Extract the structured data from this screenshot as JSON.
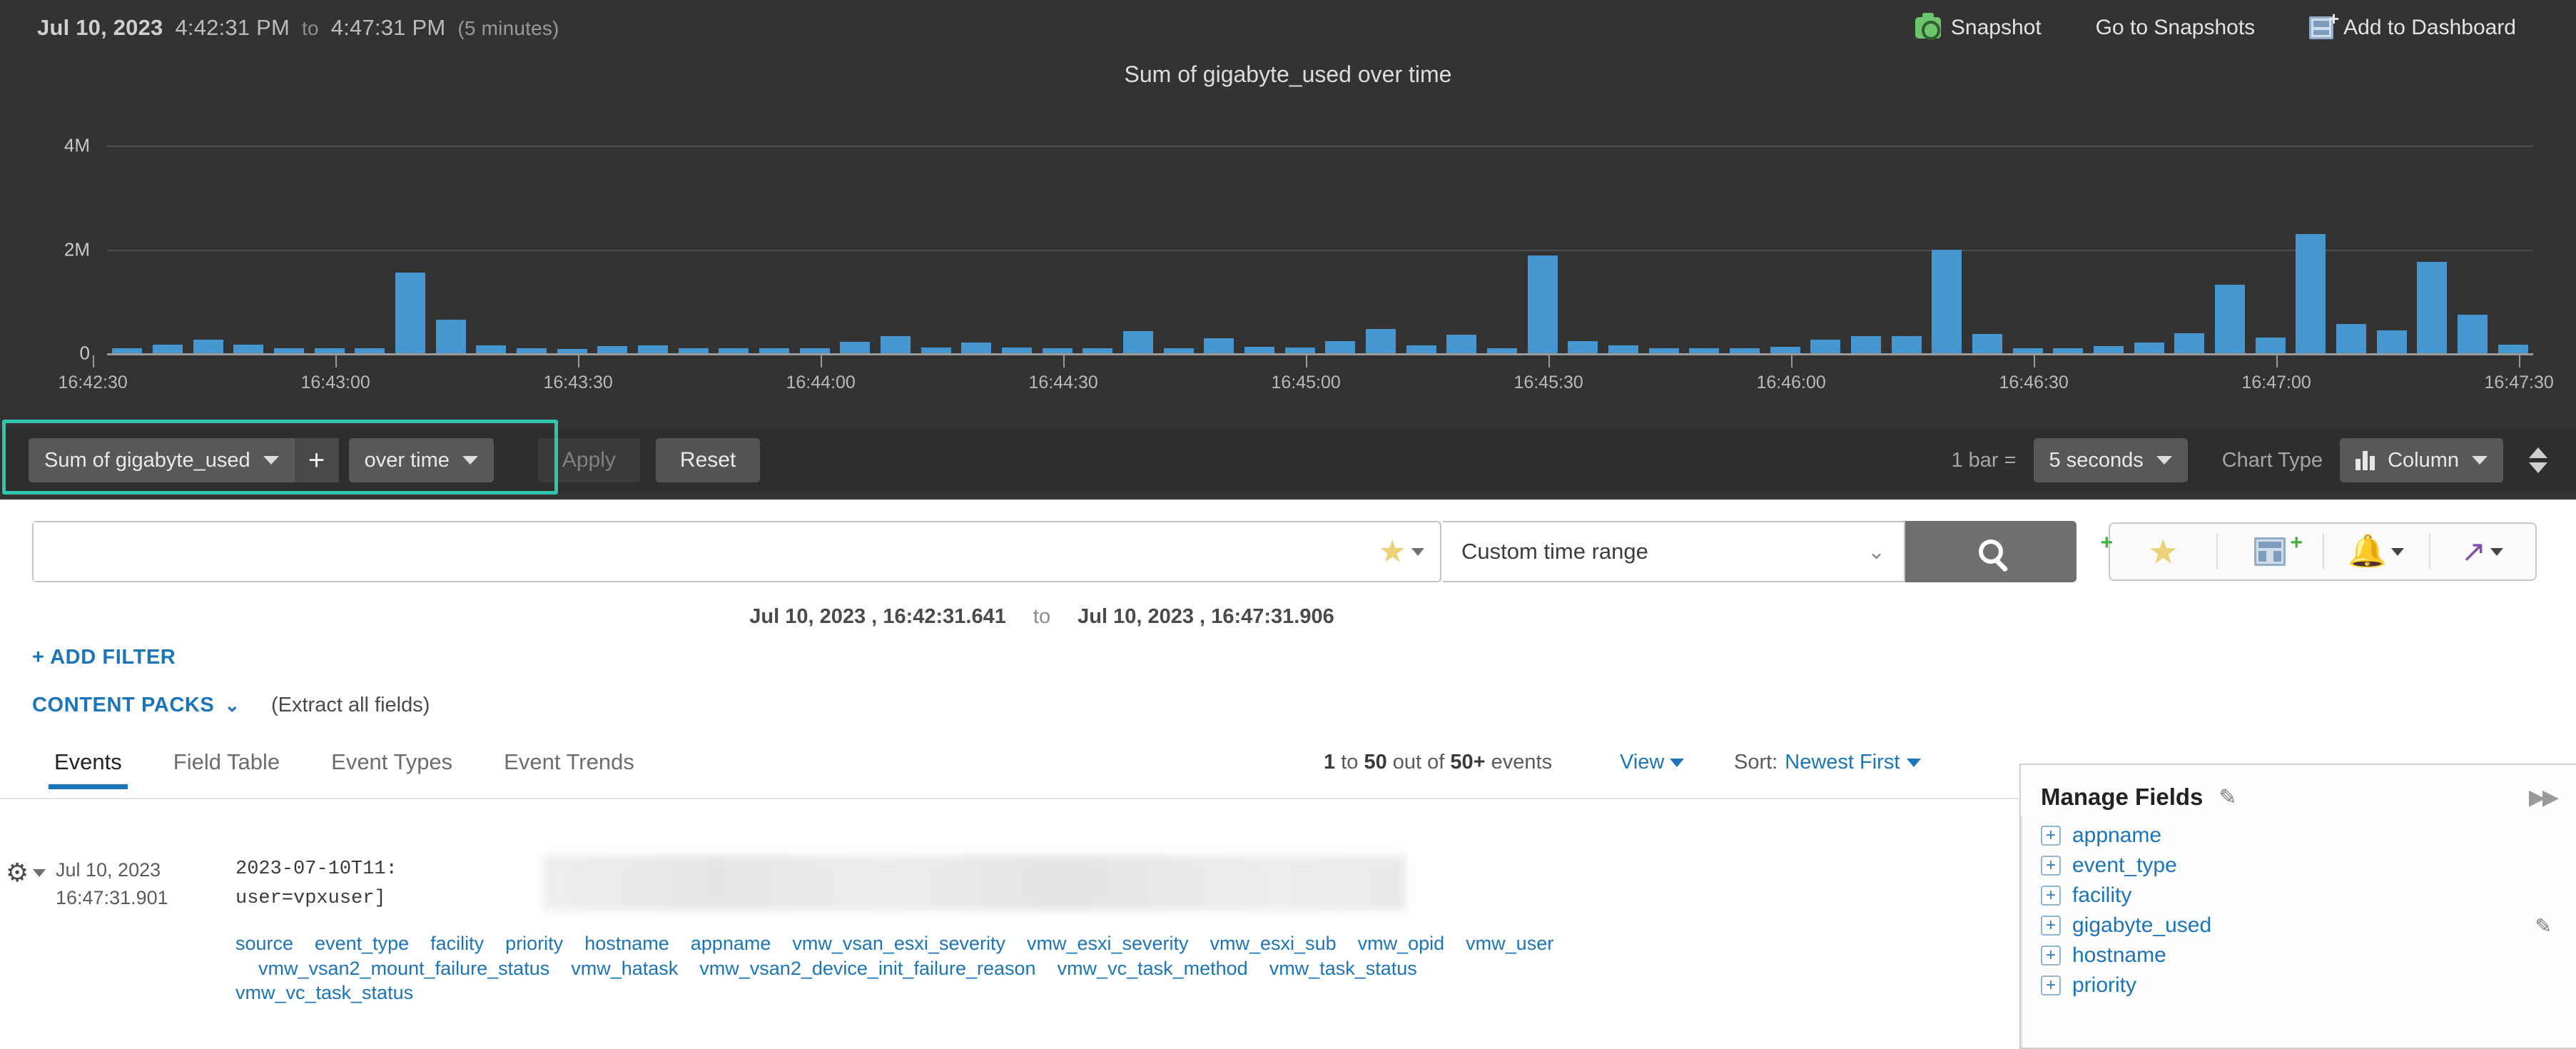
{
  "header": {
    "date": "Jul 10, 2023",
    "start_time": "4:42:31 PM",
    "to": "to",
    "end_time": "4:47:31 PM",
    "duration": "(5 minutes)",
    "actions": [
      {
        "label": "Snapshot",
        "icon": "camera-icon"
      },
      {
        "label": "Go to Snapshots",
        "icon": "none"
      },
      {
        "label": "Add to Dashboard",
        "icon": "add-dashboard-icon"
      }
    ]
  },
  "chart_data": {
    "type": "bar",
    "title": "Sum of gigabyte_used over time",
    "xlabel": "",
    "ylabel": "",
    "ylim": [
      0,
      4400000
    ],
    "yticks": [
      0,
      2000000,
      4000000
    ],
    "ytick_labels": [
      "0",
      "2M",
      "4M"
    ],
    "grid": true,
    "bar_interval_seconds": 5,
    "x_tick_labels": [
      "16:42:30",
      "16:43:00",
      "16:43:30",
      "16:44:00",
      "16:44:30",
      "16:45:00",
      "16:45:30",
      "16:46:00",
      "16:46:30",
      "16:47:00",
      "16:47:30"
    ],
    "x_start": "16:42:31",
    "x_end": "16:47:31",
    "categories": [
      "16:42:35",
      "16:42:40",
      "16:42:45",
      "16:42:50",
      "16:42:55",
      "16:43:00",
      "16:43:05",
      "16:43:10",
      "16:43:15",
      "16:43:20",
      "16:43:25",
      "16:43:30",
      "16:43:35",
      "16:43:40",
      "16:43:45",
      "16:43:50",
      "16:43:55",
      "16:44:00",
      "16:44:05",
      "16:44:10",
      "16:44:15",
      "16:44:20",
      "16:44:25",
      "16:44:30",
      "16:44:35",
      "16:44:40",
      "16:44:45",
      "16:44:50",
      "16:44:55",
      "16:45:00",
      "16:45:05",
      "16:45:10",
      "16:45:15",
      "16:45:20",
      "16:45:25",
      "16:45:30",
      "16:45:35",
      "16:45:40",
      "16:45:45",
      "16:45:50",
      "16:45:55",
      "16:46:00",
      "16:46:05",
      "16:46:10",
      "16:46:15",
      "16:46:20",
      "16:46:25",
      "16:46:30",
      "16:46:35",
      "16:46:40",
      "16:46:45",
      "16:46:50",
      "16:46:55",
      "16:47:00",
      "16:47:05",
      "16:47:10",
      "16:47:15",
      "16:47:20",
      "16:47:25",
      "16:47:30"
    ],
    "values": [
      95000,
      170000,
      260000,
      165000,
      90000,
      95000,
      95000,
      1550000,
      640000,
      150000,
      90000,
      85000,
      140000,
      150000,
      100000,
      90000,
      90000,
      95000,
      220000,
      330000,
      110000,
      210000,
      105000,
      95000,
      100000,
      430000,
      100000,
      290000,
      120000,
      110000,
      230000,
      470000,
      150000,
      360000,
      100000,
      1880000,
      230000,
      150000,
      100000,
      90000,
      90000,
      130000,
      265000,
      330000,
      330000,
      1990000,
      370000,
      95000,
      95000,
      140000,
      200000,
      390000,
      1320000,
      300000,
      2300000,
      570000,
      440000,
      1760000,
      740000,
      170000
    ]
  },
  "query_builder": {
    "metric": "Sum of gigabyte_used",
    "add_button": "+",
    "group_by": "over time",
    "apply": "Apply",
    "reset": "Reset",
    "bar_label": "1 bar =",
    "bar_interval": "5 seconds",
    "chart_type_label": "Chart Type",
    "chart_type": "Column"
  },
  "search": {
    "query": "",
    "placeholder": "",
    "time_range": "Custom time range",
    "search_icon": "magnifier-icon",
    "star_icon": "star-icon",
    "toolbar_icons": [
      "add-favorite-icon",
      "add-dashboard-icon",
      "alert-icon",
      "share-icon"
    ]
  },
  "time_range_detail": {
    "from_date": "Jul 10, 2023 ,",
    "from_time": "16:42:31.641",
    "sep": "to",
    "to_date": "Jul 10, 2023 ,",
    "to_time": "16:47:31.906"
  },
  "filters": {
    "add_filter": "+ ADD FILTER",
    "content_packs": "CONTENT PACKS",
    "extract": "(Extract all fields)"
  },
  "tabs": [
    {
      "label": "Events",
      "active": true
    },
    {
      "label": "Field Table",
      "active": false
    },
    {
      "label": "Event Types",
      "active": false
    },
    {
      "label": "Event Trends",
      "active": false
    }
  ],
  "results": {
    "count_prefix": "1",
    "count_text": " to ",
    "count_end": "50",
    "count_out": " out of ",
    "count_total": "50+",
    "count_suffix": " events",
    "full_count": "1 to 50 out of 50+ events",
    "view_label": "View",
    "sort_label": "Sort:",
    "sort_value": "Newest First"
  },
  "event": {
    "date": "Jul 10, 2023",
    "time": "16:47:31.901",
    "line1": "2023-07-10T11:",
    "line2": "user=vpxuser]",
    "fields_row1": [
      "source",
      "event_type",
      "facility",
      "priority",
      "hostname",
      "appname",
      "vmw_vsan_esxi_severity",
      "vmw_esxi_severity",
      "vmw_esxi_sub",
      "vmw_opid",
      "vmw_user"
    ],
    "fields_row2": [
      "vmw_vsan2_mount_failure_status",
      "vmw_hatask",
      "vmw_vsan2_device_init_failure_reason",
      "vmw_vc_task_method",
      "vmw_task_status"
    ],
    "fields_row3": [
      "vmw_vc_task_status"
    ]
  },
  "manage_fields": {
    "title": "Manage Fields",
    "edit_icon": "pencil-icon",
    "expand_icon": "double-chevron-right-icon",
    "items": [
      {
        "label": "appname",
        "has_edit": false
      },
      {
        "label": "event_type",
        "has_edit": false
      },
      {
        "label": "facility",
        "has_edit": false
      },
      {
        "label": "gigabyte_used",
        "has_edit": true
      },
      {
        "label": "hostname",
        "has_edit": false
      },
      {
        "label": "priority",
        "has_edit": false
      }
    ]
  },
  "colors": {
    "bar": "#4596d1",
    "panel_bg": "#333333",
    "highlight": "#2ec4ae",
    "link": "#1b75bb"
  }
}
